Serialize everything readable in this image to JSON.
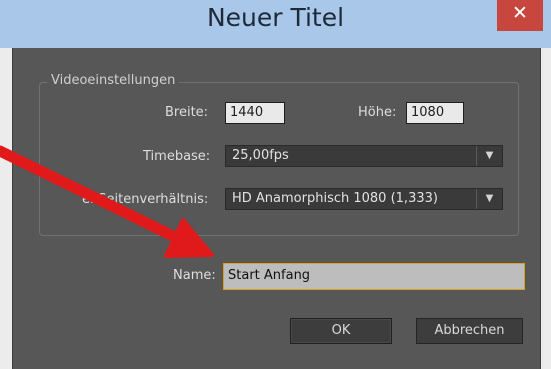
{
  "dialog": {
    "title": "Neuer Titel",
    "close_label": "✕"
  },
  "video_settings": {
    "group_label": "Videoeinstellungen",
    "width_label": "Breite:",
    "width_value": "1440",
    "height_label": "Höhe:",
    "height_value": "1080",
    "timebase_label": "Timebase:",
    "timebase_value": "25,00fps",
    "pixel_aspect_label": "Pixel-Seitenverhältnis:",
    "pixel_aspect_visible_label": "el-Seitenverhältnis:",
    "pixel_aspect_value": "HD Anamorphisch 1080 (1,333)"
  },
  "name": {
    "label": "Name:",
    "value": "Start Anfang"
  },
  "buttons": {
    "ok": "OK",
    "cancel": "Abbrechen"
  },
  "annotation": {
    "arrow_color": "#e01a1a"
  }
}
